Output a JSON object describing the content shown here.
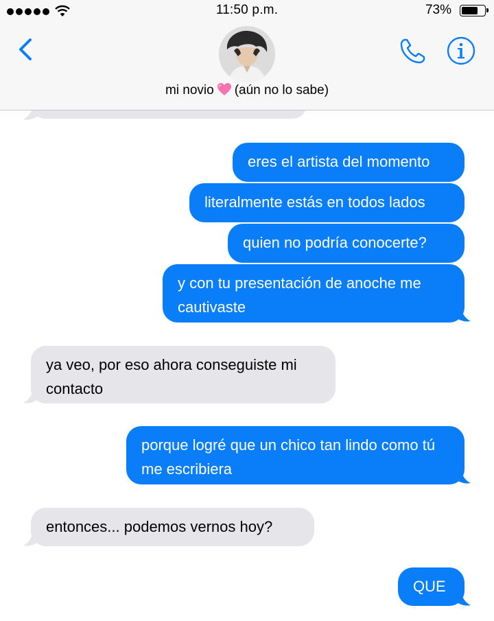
{
  "status_bar": {
    "time": "11:50 p.m.",
    "battery_percent": "73%",
    "battery_level": 0.73
  },
  "contact": {
    "name_prefix": "mi novio",
    "name_suffix": "(aún no lo sabe)",
    "emoji": "pink-heart"
  },
  "colors": {
    "sent_bubble": "#0a7df9",
    "received_bubble": "#e5e5ea",
    "accent": "#0a7df9"
  },
  "messages": [
    {
      "from": "contact",
      "text": ""
    },
    {
      "from": "me",
      "text": "eres el artista del momento"
    },
    {
      "from": "me",
      "text": "literalmente estás en todos lados"
    },
    {
      "from": "me",
      "text": "quien no podría conocerte?"
    },
    {
      "from": "me",
      "text": "y con tu presentación de anoche me cautivaste"
    },
    {
      "from": "contact",
      "text": "ya veo, por eso ahora conseguiste mi contacto"
    },
    {
      "from": "me",
      "text": "porque logré que un chico tan lindo como tú me escribiera"
    },
    {
      "from": "contact",
      "text": "entonces... podemos vernos hoy?"
    },
    {
      "from": "me",
      "text": "QUE"
    }
  ]
}
